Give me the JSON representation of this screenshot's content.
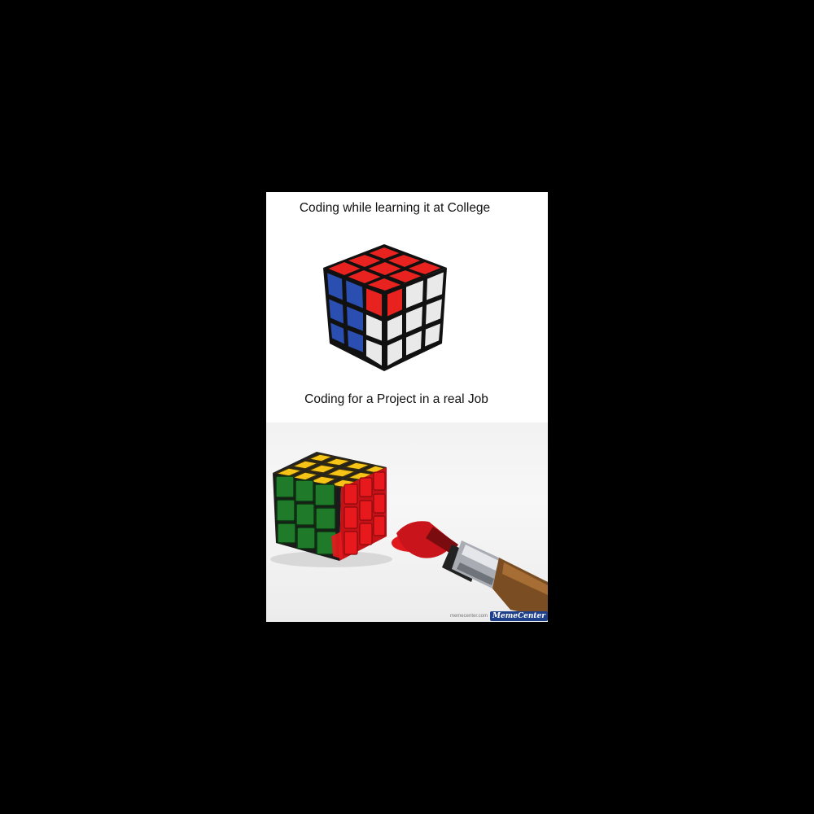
{
  "meme": {
    "caption_top": "Coding while learning it at College",
    "caption_bottom": "Coding for a Project in a real Job",
    "watermark_small": "memecenter.com",
    "watermark_logo": "MemeCenter"
  },
  "colors": {
    "background": "#000000",
    "panel": "#ffffff",
    "cube_red": "#e8231f",
    "cube_blue": "#2b4fb0",
    "cube_white": "#e9e9e9",
    "cube_yellow": "#f6c417",
    "cube_green": "#1f7a2a",
    "paint_red": "#e0191e"
  }
}
